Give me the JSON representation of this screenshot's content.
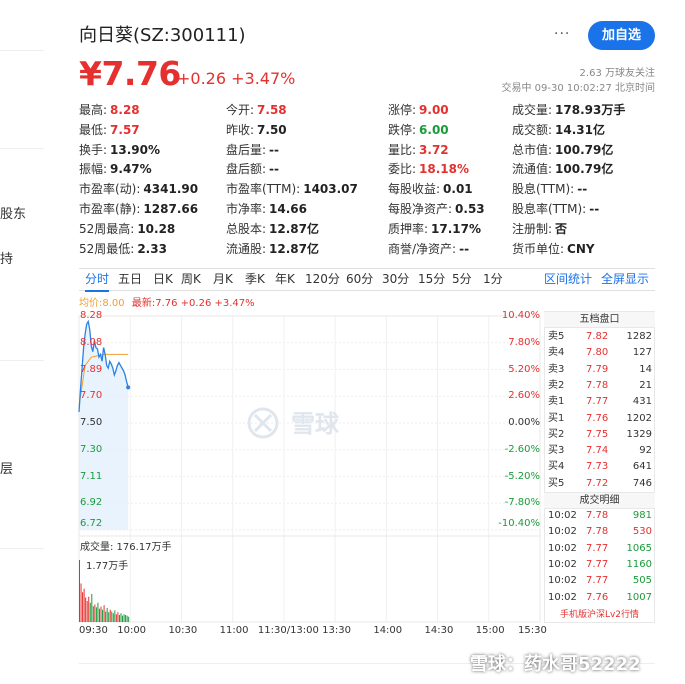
{
  "left_sidebar": {
    "fragments": [
      "股东",
      "持",
      "层"
    ]
  },
  "header": {
    "title": "向日葵(SZ:300111)",
    "more": "···",
    "follow_button": "加自选"
  },
  "price": {
    "current": "¥7.76",
    "change": "+0.26",
    "change_pct": "+3.47%",
    "fans": "2.63 万球友关注",
    "trade_status": "交易中 09-30 10:02:27 北京时间"
  },
  "quotes": [
    [
      {
        "label": "最高:",
        "value": "8.28",
        "c": "r"
      },
      {
        "label": "今开:",
        "value": "7.58",
        "c": "r"
      },
      {
        "label": "涨停:",
        "value": "9.00",
        "c": "r"
      },
      {
        "label": "成交量:",
        "value": "178.93万手",
        "c": ""
      }
    ],
    [
      {
        "label": "最低:",
        "value": "7.57",
        "c": "r"
      },
      {
        "label": "昨收:",
        "value": "7.50",
        "c": ""
      },
      {
        "label": "跌停:",
        "value": "6.00",
        "c": "g"
      },
      {
        "label": "成交额:",
        "value": "14.31亿",
        "c": ""
      }
    ],
    [
      {
        "label": "换手:",
        "value": "13.90%",
        "c": ""
      },
      {
        "label": "盘后量:",
        "value": "--",
        "c": ""
      },
      {
        "label": "量比:",
        "value": "3.72",
        "c": "r"
      },
      {
        "label": "总市值:",
        "value": "100.79亿",
        "c": ""
      }
    ],
    [
      {
        "label": "振幅:",
        "value": "9.47%",
        "c": ""
      },
      {
        "label": "盘后额:",
        "value": "--",
        "c": ""
      },
      {
        "label": "委比:",
        "value": "18.18%",
        "c": "r"
      },
      {
        "label": "流通值:",
        "value": "100.79亿",
        "c": ""
      }
    ],
    [
      {
        "label": "市盈率(动):",
        "value": "4341.90",
        "c": ""
      },
      {
        "label": "市盈率(TTM):",
        "value": "1403.07",
        "c": ""
      },
      {
        "label": "每股收益:",
        "value": "0.01",
        "c": ""
      },
      {
        "label": "股息(TTM):",
        "value": "--",
        "c": ""
      }
    ],
    [
      {
        "label": "市盈率(静):",
        "value": "1287.66",
        "c": ""
      },
      {
        "label": "市净率:",
        "value": "14.66",
        "c": ""
      },
      {
        "label": "每股净资产:",
        "value": "0.53",
        "c": ""
      },
      {
        "label": "股息率(TTM):",
        "value": "--",
        "c": ""
      }
    ],
    [
      {
        "label": "52周最高:",
        "value": "10.28",
        "c": ""
      },
      {
        "label": "总股本:",
        "value": "12.87亿",
        "c": ""
      },
      {
        "label": "质押率:",
        "value": "17.17%",
        "c": ""
      },
      {
        "label": "注册制:",
        "value": "否",
        "c": ""
      }
    ],
    [
      {
        "label": "52周最低:",
        "value": "2.33",
        "c": ""
      },
      {
        "label": "流通股:",
        "value": "12.87亿",
        "c": ""
      },
      {
        "label": "商誉/净资产:",
        "value": "--",
        "c": ""
      },
      {
        "label": "货币单位:",
        "value": "CNY",
        "c": ""
      }
    ]
  ],
  "chart_tabs": [
    "分时",
    "五日",
    "日K",
    "周K",
    "月K",
    "季K",
    "年K",
    "120分",
    "60分",
    "30分",
    "15分",
    "5分",
    "1分"
  ],
  "chart_links": {
    "order_stats": "区间统计",
    "fullscreen": "全屏显示"
  },
  "legend": {
    "avg_label": "均价:",
    "avg_value": "8.00",
    "latest_label": "最新:",
    "latest_value": "7.76",
    "latest_change": "+0.26",
    "latest_pct": "+3.47%"
  },
  "chart_data": {
    "type": "line",
    "y_price_ticks": [
      "8.28",
      "8.08",
      "7.89",
      "7.70",
      "7.50",
      "7.30",
      "7.11",
      "6.92",
      "6.72"
    ],
    "y_pct_ticks": [
      "10.40%",
      "7.80%",
      "5.20%",
      "2.60%",
      "0.00%",
      "-2.60%",
      "-5.20%",
      "-7.80%",
      "-10.40%"
    ],
    "x_ticks": [
      "09:30",
      "10:00",
      "10:30",
      "11:00",
      "11:30/13:00",
      "13:30",
      "14:00",
      "14:30",
      "15:00",
      "15:30"
    ],
    "ylim": [
      6.72,
      8.28
    ],
    "prev_close": 7.5,
    "price_series": {
      "x_minutes": [
        0,
        1,
        2,
        3,
        4,
        5,
        6,
        7,
        8,
        9,
        10,
        11,
        12,
        13,
        14,
        15,
        16,
        17,
        18,
        19,
        20,
        21,
        22,
        23,
        24,
        25,
        26,
        27,
        28,
        29,
        30,
        31,
        32
      ],
      "values": [
        7.58,
        7.75,
        7.9,
        8.05,
        8.15,
        8.22,
        8.24,
        8.18,
        8.06,
        8.02,
        8.1,
        8.05,
        8.04,
        7.98,
        8.0,
        7.95,
        8.05,
        8.0,
        7.92,
        7.9,
        7.95,
        7.93,
        7.9,
        7.85,
        7.88,
        7.92,
        7.94,
        7.92,
        7.9,
        7.88,
        7.85,
        7.8,
        7.76
      ]
    },
    "avg_series": {
      "x_minutes": [
        0,
        4,
        8,
        12,
        16,
        20,
        24,
        28,
        32
      ],
      "values": [
        7.62,
        7.92,
        7.98,
        7.99,
        8.0,
        8.0,
        8.0,
        8.0,
        8.0
      ]
    },
    "volume_label": "成交量: 176.17万手",
    "volume_max_label": "1.77万手",
    "volume_values": [
      1.77,
      1.1,
      0.85,
      0.95,
      0.7,
      0.6,
      0.72,
      0.55,
      0.8,
      0.45,
      0.5,
      0.42,
      0.55,
      0.38,
      0.44,
      0.35,
      0.48,
      0.3,
      0.4,
      0.28,
      0.35,
      0.3,
      0.25,
      0.33,
      0.22,
      0.28,
      0.2,
      0.25,
      0.18,
      0.22,
      0.2,
      0.18,
      0.15
    ]
  },
  "order_book": {
    "title": "五档盘口",
    "sell": [
      {
        "label": "卖5",
        "price": "7.82",
        "vol": "1282"
      },
      {
        "label": "卖4",
        "price": "7.80",
        "vol": "127"
      },
      {
        "label": "卖3",
        "price": "7.79",
        "vol": "14"
      },
      {
        "label": "卖2",
        "price": "7.78",
        "vol": "21"
      },
      {
        "label": "卖1",
        "price": "7.77",
        "vol": "431"
      }
    ],
    "buy": [
      {
        "label": "买1",
        "price": "7.76",
        "vol": "1202"
      },
      {
        "label": "买2",
        "price": "7.75",
        "vol": "1329"
      },
      {
        "label": "买3",
        "price": "7.74",
        "vol": "92"
      },
      {
        "label": "买4",
        "price": "7.73",
        "vol": "641"
      },
      {
        "label": "买5",
        "price": "7.72",
        "vol": "746"
      }
    ]
  },
  "trades": {
    "title": "成交明细",
    "rows": [
      {
        "time": "10:02",
        "price": "7.78",
        "vol": "981",
        "c": "g"
      },
      {
        "time": "10:02",
        "price": "7.78",
        "vol": "530",
        "c": "r"
      },
      {
        "time": "10:02",
        "price": "7.77",
        "vol": "1065",
        "c": "g"
      },
      {
        "time": "10:02",
        "price": "7.77",
        "vol": "1160",
        "c": "g"
      },
      {
        "time": "10:02",
        "price": "7.77",
        "vol": "505",
        "c": "g"
      },
      {
        "time": "10:02",
        "price": "7.76",
        "vol": "1007",
        "c": "g"
      }
    ]
  },
  "lv2_link": "手机版沪深Lv2行情",
  "watermark": "雪球",
  "footer_watermark": "雪球：药水哥52222",
  "colors": {
    "up": "#e4312f",
    "down": "#1a9b3a",
    "accent": "#1a73e8",
    "line": "#2a82e4",
    "avg": "#f0a030"
  }
}
